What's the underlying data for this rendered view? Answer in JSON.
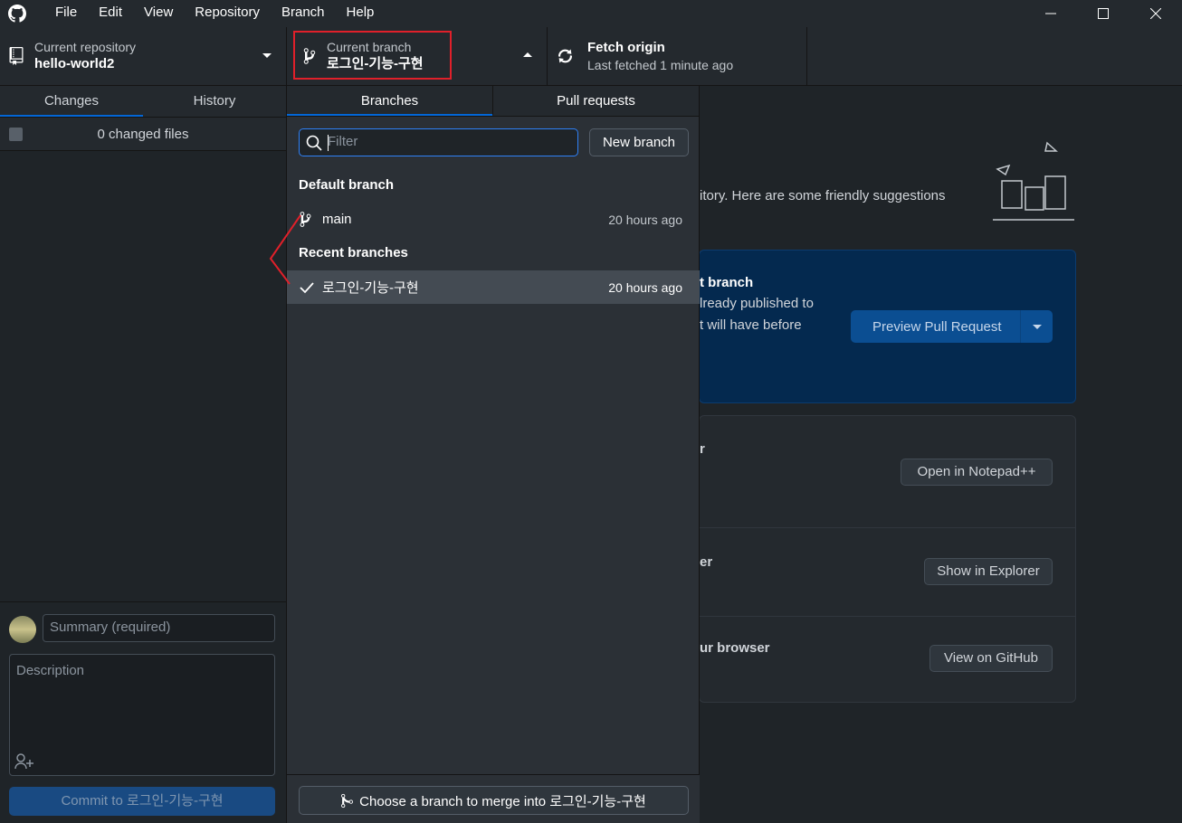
{
  "menu": [
    "File",
    "Edit",
    "View",
    "Repository",
    "Branch",
    "Help"
  ],
  "toolbar": {
    "repo_label": "Current repository",
    "repo_name": "hello-world2",
    "branch_label": "Current branch",
    "branch_name": "로그인-기능-구현",
    "fetch_label": "Fetch origin",
    "fetch_status": "Last fetched 1 minute ago"
  },
  "left_panel": {
    "tabs": [
      "Changes",
      "History"
    ],
    "changed_files": "0 changed files",
    "summary_placeholder": "Summary (required)",
    "description_placeholder": "Description",
    "commit_button": "Commit to 로그인-기능-구현"
  },
  "dropdown": {
    "tabs": [
      "Branches",
      "Pull requests"
    ],
    "filter_placeholder": "Filter",
    "new_branch": "New branch",
    "default_label": "Default branch",
    "default_branch": {
      "name": "main",
      "time": "20 hours ago"
    },
    "recent_label": "Recent branches",
    "recent_branches": [
      {
        "name": "로그인-기능-구현",
        "time": "20 hours ago",
        "selected": true
      }
    ],
    "merge_button": "Choose a branch to merge into 로그인-기능-구현"
  },
  "main": {
    "intro_fragment": "itory. Here are some friendly suggestions",
    "pr_title_fragment": "t branch",
    "pr_line1_fragment": "lready published to",
    "pr_line2_fragment": "t will have before",
    "pr_button": "Preview Pull Request",
    "row1_fragment": "r",
    "row1_button": "Open in Notepad++",
    "row2_fragment": "er",
    "row2_button": "Show in Explorer",
    "row3_fragment": "ur browser",
    "row3_button": "View on GitHub"
  },
  "colors": {
    "accent": "#0366d6",
    "highlight": "#e0202a",
    "pr_button": "#0b4e92"
  }
}
